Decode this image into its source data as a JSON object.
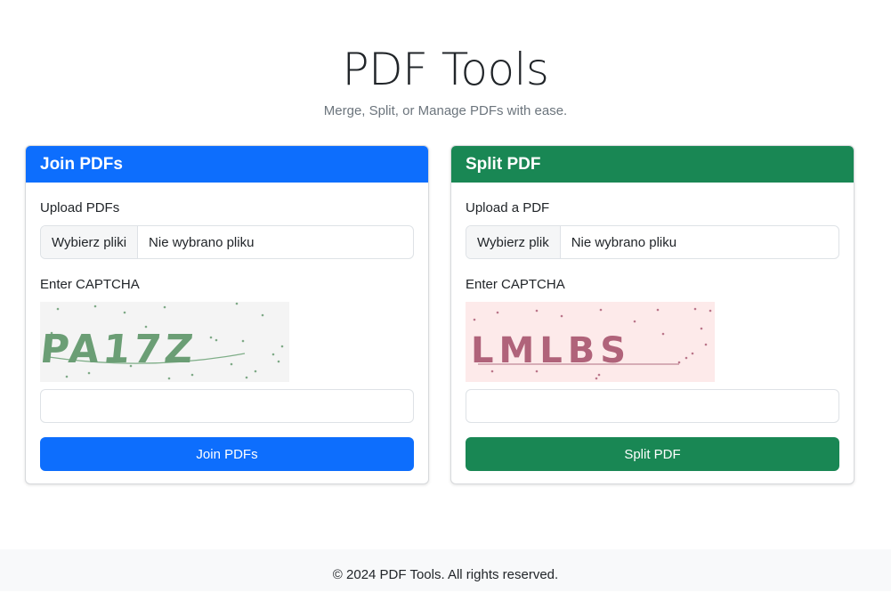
{
  "header": {
    "title": "PDF Tools",
    "subtitle": "Merge, Split, or Manage PDFs with ease."
  },
  "join": {
    "title": "Join PDFs",
    "upload_label": "Upload PDFs",
    "file_button": "Wybierz pliki",
    "file_status": "Nie wybrano pliku",
    "captcha_label": "Enter CAPTCHA",
    "captcha_text": "PA17Z",
    "captcha_input_value": "",
    "submit_label": "Join PDFs"
  },
  "split": {
    "title": "Split PDF",
    "upload_label": "Upload a PDF",
    "file_button": "Wybierz plik",
    "file_status": "Nie wybrano pliku",
    "captcha_label": "Enter CAPTCHA",
    "captcha_text": "LMLBS",
    "captcha_input_value": "",
    "submit_label": "Split PDF"
  },
  "footer": {
    "text": "© 2024 PDF Tools. All rights reserved."
  },
  "colors": {
    "primary": "#0d6efd",
    "success": "#198754",
    "captcha_join_bg": "#f4f4f4",
    "captcha_join_fg": "#6b9e75",
    "captcha_split_bg": "#fdeaea",
    "captcha_split_fg": "#b0637a"
  }
}
